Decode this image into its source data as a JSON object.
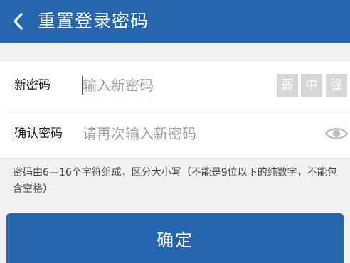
{
  "header": {
    "title": "重置登录密码",
    "back_icon": "chevron-left-icon",
    "background": "#2566b0"
  },
  "form": {
    "new_password": {
      "label": "新密码",
      "placeholder": "输入新密码",
      "value": "",
      "strength": [
        "弱",
        "中",
        "强"
      ]
    },
    "confirm_password": {
      "label": "确认密码",
      "placeholder": "请再次输入新密码",
      "value": "",
      "toggle_icon": "eye-icon"
    }
  },
  "hint": "密码由6—16个字符组成，区分大小写（不能是9位以下的纯数字，不能包含空格）",
  "confirm_button": {
    "label": "确定",
    "background": "#2566b0"
  }
}
